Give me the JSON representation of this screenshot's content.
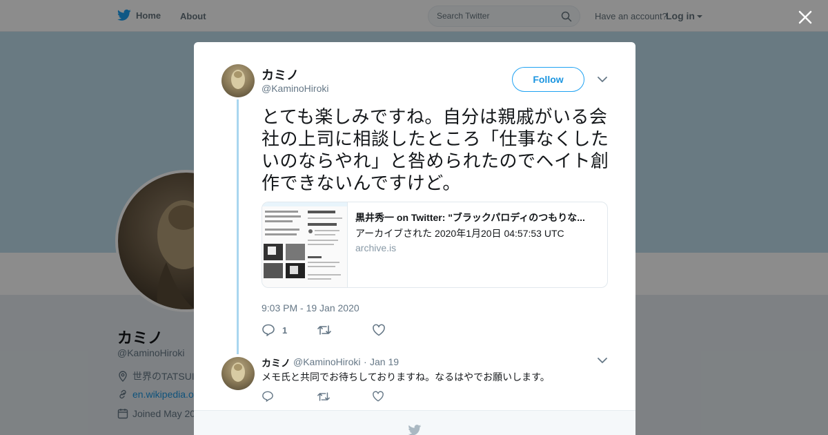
{
  "nav": {
    "home": "Home",
    "about": "About",
    "search_placeholder": "Search Twitter",
    "have_account": "Have an account?",
    "login": "Log in"
  },
  "profile": {
    "name": "カミノ",
    "handle": "@KaminoHiroki",
    "location": "世界のTATSUI",
    "url": "en.wikipedia.o",
    "joined": "Joined May 20"
  },
  "tweet": {
    "author_name": "カミノ",
    "author_handle": "@KaminoHiroki",
    "follow_label": "Follow",
    "text": "とても楽しみですね。自分は親戚がいる会社の上司に相談したところ「仕事なくしたいのならやれ」と咎められたのでヘイト創作できないんですけど。",
    "card": {
      "title": "黒井秀一 on Twitter: \"ブラックパロディのつもりな...",
      "description": "アーカイブされた 2020年1月20日 04:57:53 UTC",
      "domain": "archive.is"
    },
    "timestamp": "9:03 PM - 19 Jan 2020",
    "reply_count": "1"
  },
  "reply": {
    "author_name": "カミノ",
    "author_handle": "@KaminoHiroki",
    "separator": "·",
    "date": "Jan 19",
    "text": "メモ氏と共同でお待ちしておりますね。なるはやでお願いします。"
  },
  "colors": {
    "brand": "#1da1f2",
    "banner": "#c0deed",
    "thread_line": "#a9d6ef"
  },
  "icons": [
    "twitter-bird-icon",
    "search-icon",
    "close-icon",
    "chevron-down-icon",
    "reply-icon",
    "retweet-icon",
    "like-icon",
    "location-icon",
    "link-icon",
    "calendar-icon"
  ]
}
